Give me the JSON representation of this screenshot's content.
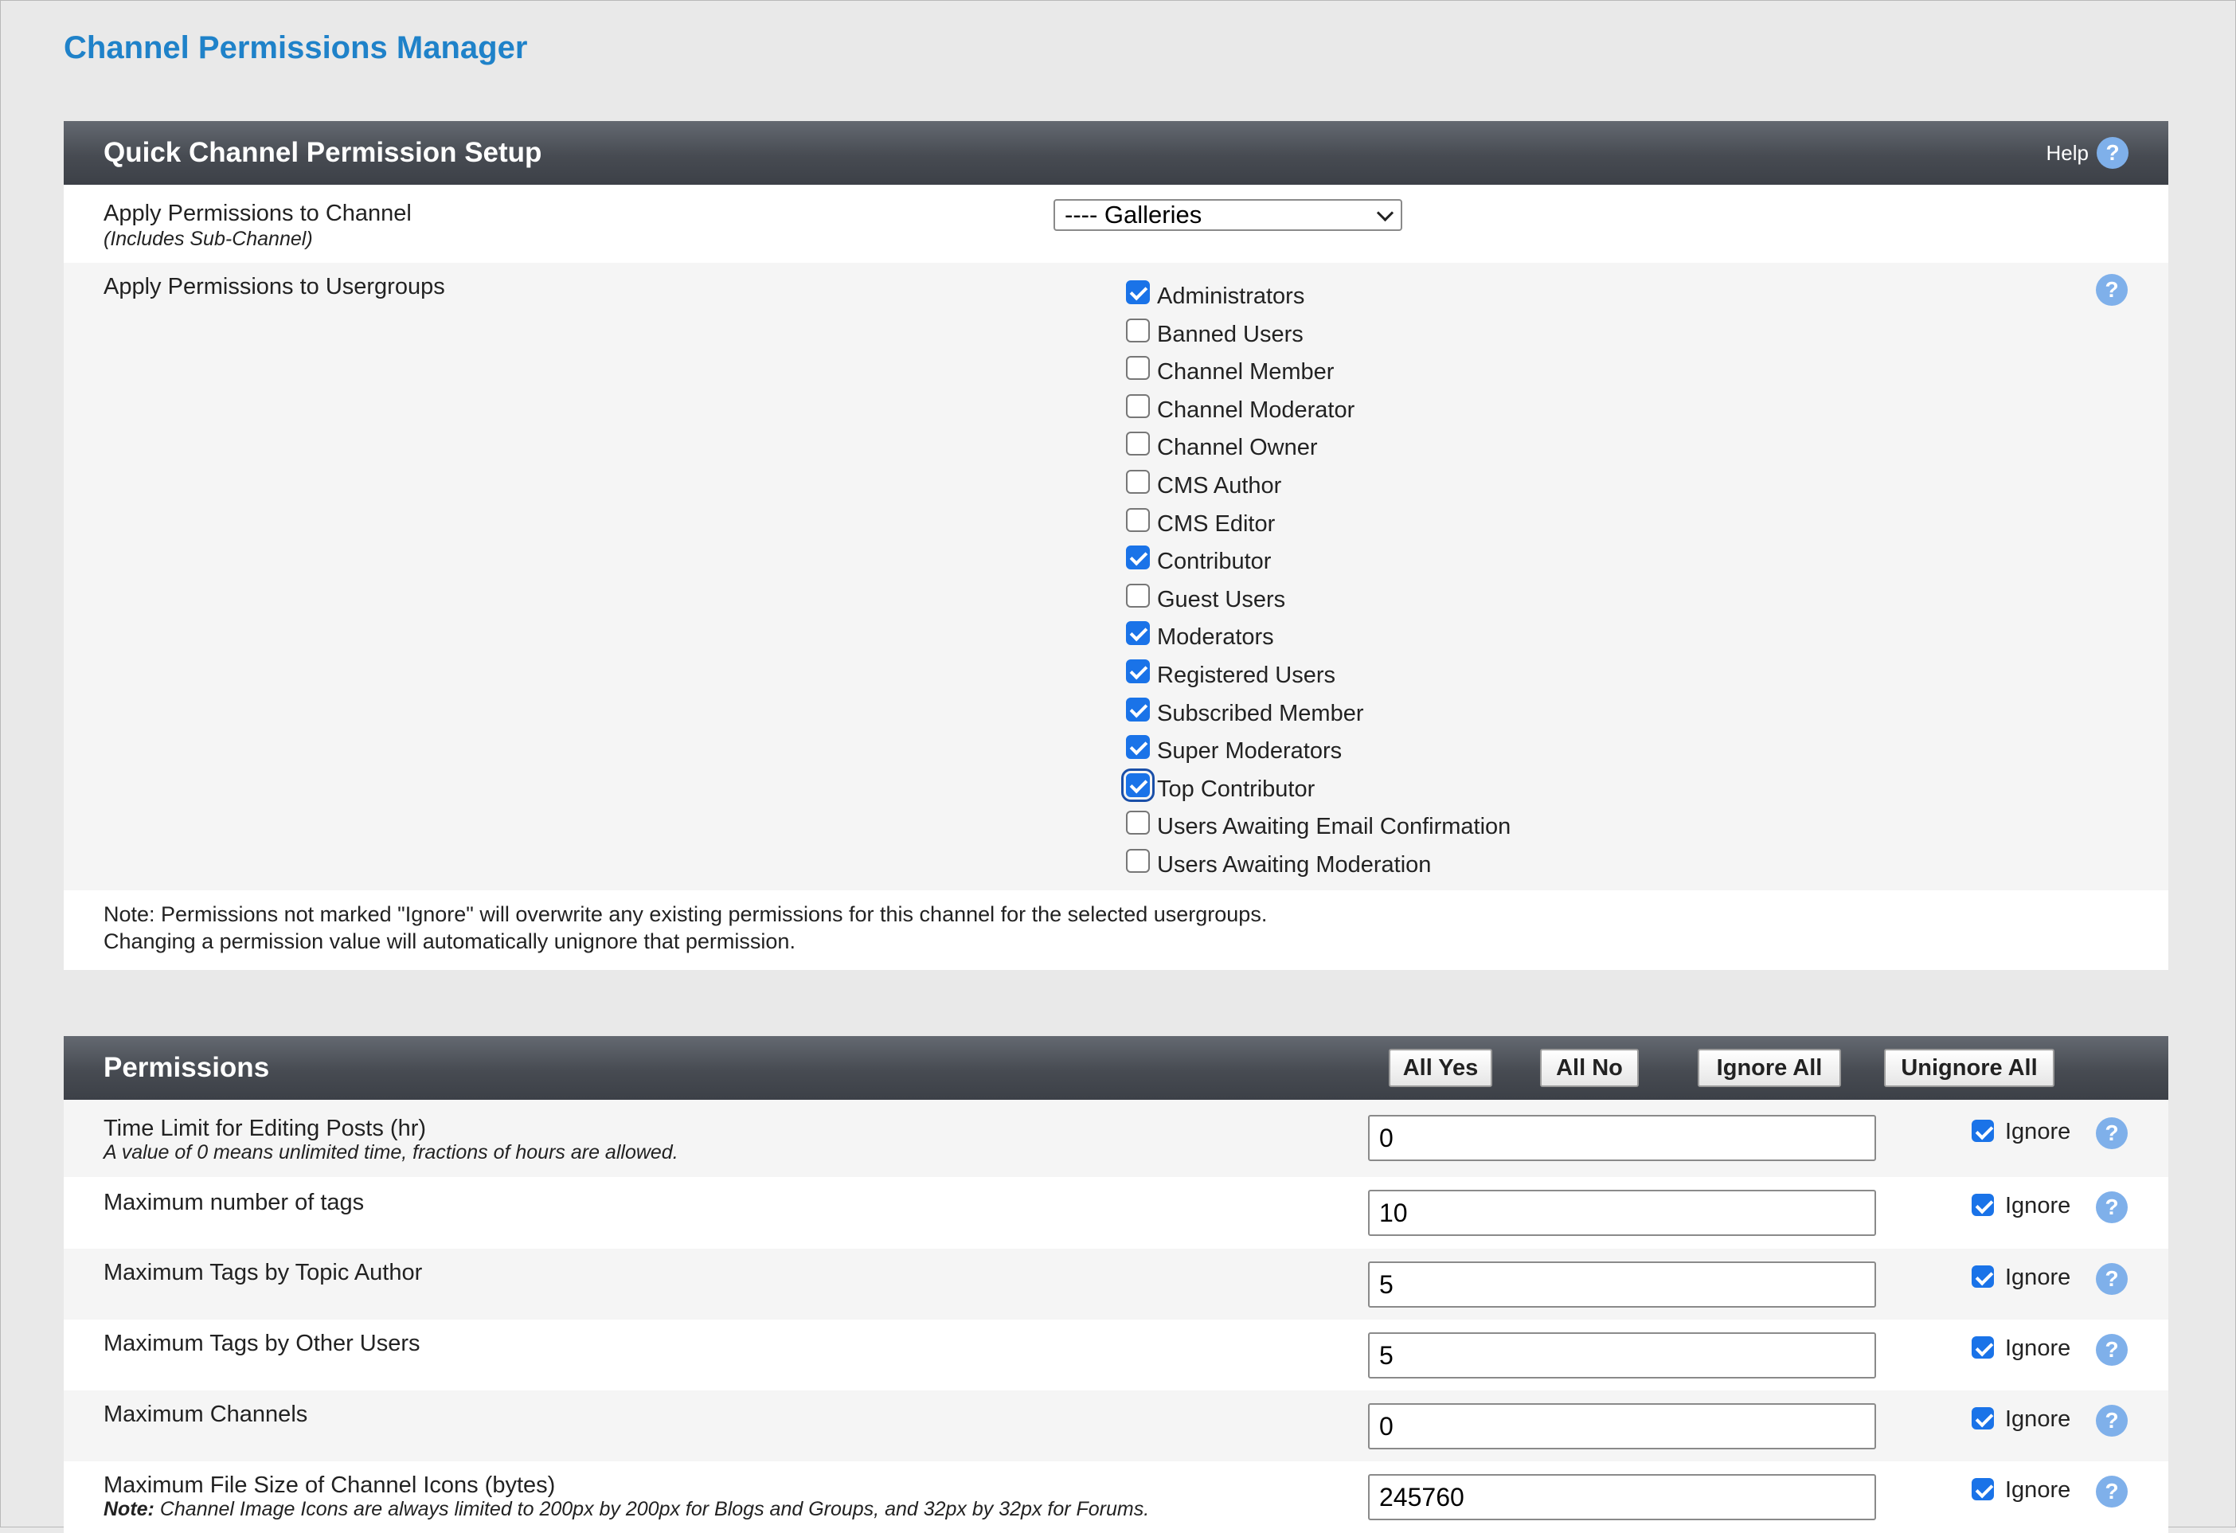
{
  "page_title": "Channel Permissions Manager",
  "quick_setup": {
    "title": "Quick Channel Permission Setup",
    "help_label": "Help",
    "channel_label": "Apply Permissions to Channel",
    "channel_sublabel": "(Includes Sub-Channel)",
    "channel_selected": "---- Galleries",
    "usergroups_label": "Apply Permissions to Usergroups",
    "usergroups": [
      {
        "label": "Administrators",
        "checked": true
      },
      {
        "label": "Banned Users",
        "checked": false
      },
      {
        "label": "Channel Member",
        "checked": false
      },
      {
        "label": "Channel Moderator",
        "checked": false
      },
      {
        "label": "Channel Owner",
        "checked": false
      },
      {
        "label": "CMS Author",
        "checked": false
      },
      {
        "label": "CMS Editor",
        "checked": false
      },
      {
        "label": "Contributor",
        "checked": true
      },
      {
        "label": "Guest Users",
        "checked": false
      },
      {
        "label": "Moderators",
        "checked": true
      },
      {
        "label": "Registered Users",
        "checked": true
      },
      {
        "label": "Subscribed Member",
        "checked": true
      },
      {
        "label": "Super Moderators",
        "checked": true
      },
      {
        "label": "Top Contributor",
        "checked": true,
        "focused": true
      },
      {
        "label": "Users Awaiting Email Confirmation",
        "checked": false
      },
      {
        "label": "Users Awaiting Moderation",
        "checked": false
      }
    ],
    "note_line1": "Note: Permissions not marked \"Ignore\" will overwrite any existing permissions for this channel for the selected usergroups.",
    "note_line2": "Changing a permission value will automatically unignore that permission."
  },
  "permissions": {
    "title": "Permissions",
    "buttons": {
      "all_yes": "All Yes",
      "all_no": "All No",
      "ignore_all": "Ignore All",
      "unignore_all": "Unignore All"
    },
    "ignore_label": "Ignore",
    "rows": [
      {
        "label": "Time Limit for Editing Posts (hr)",
        "note": "A value of 0 means unlimited time, fractions of hours are allowed.",
        "value": "0",
        "ignore": true
      },
      {
        "label": "Maximum number of tags",
        "value": "10",
        "ignore": true
      },
      {
        "label": "Maximum Tags by Topic Author",
        "value": "5",
        "ignore": true
      },
      {
        "label": "Maximum Tags by Other Users",
        "value": "5",
        "ignore": true
      },
      {
        "label": "Maximum Channels",
        "value": "0",
        "ignore": true
      },
      {
        "label": "Maximum File Size of Channel Icons (bytes)",
        "note_bold": "Note:",
        "note": " Channel Image Icons are always limited to 200px by 200px for Blogs and Groups, and 32px by 32px for Forums.",
        "value": "245760",
        "ignore": true
      }
    ]
  }
}
